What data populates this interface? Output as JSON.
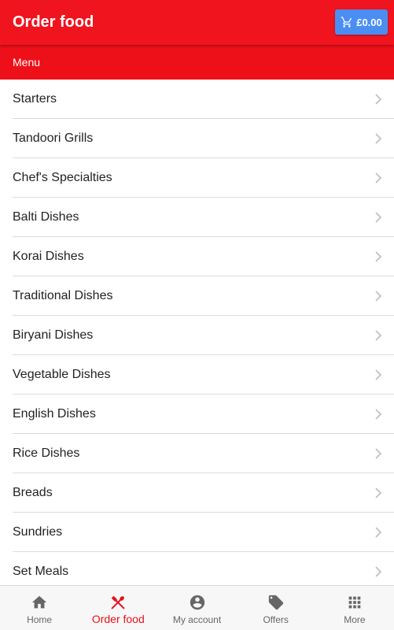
{
  "header": {
    "title": "Order food",
    "cart_total": "£0.00"
  },
  "subheader": {
    "label": "Menu"
  },
  "menu": {
    "items": [
      {
        "label": "Starters"
      },
      {
        "label": "Tandoori Grills"
      },
      {
        "label": "Chef's Specialties"
      },
      {
        "label": "Balti Dishes"
      },
      {
        "label": "Korai Dishes"
      },
      {
        "label": "Traditional Dishes"
      },
      {
        "label": "Biryani Dishes"
      },
      {
        "label": "Vegetable Dishes"
      },
      {
        "label": "English Dishes"
      },
      {
        "label": "Rice Dishes"
      },
      {
        "label": "Breads"
      },
      {
        "label": "Sundries"
      },
      {
        "label": "Set Meals"
      }
    ]
  },
  "bottom_nav": {
    "items": [
      {
        "label": "Home",
        "icon": "home-icon"
      },
      {
        "label": "Order food",
        "icon": "fork-spoon-icon",
        "active": true
      },
      {
        "label": "My account",
        "icon": "account-icon"
      },
      {
        "label": "Offers",
        "icon": "tags-icon"
      },
      {
        "label": "More",
        "icon": "grid-icon"
      }
    ]
  },
  "colors": {
    "brand": "#f0141e",
    "cart_button": "#4a8ef4",
    "active_nav": "#e8101b"
  }
}
